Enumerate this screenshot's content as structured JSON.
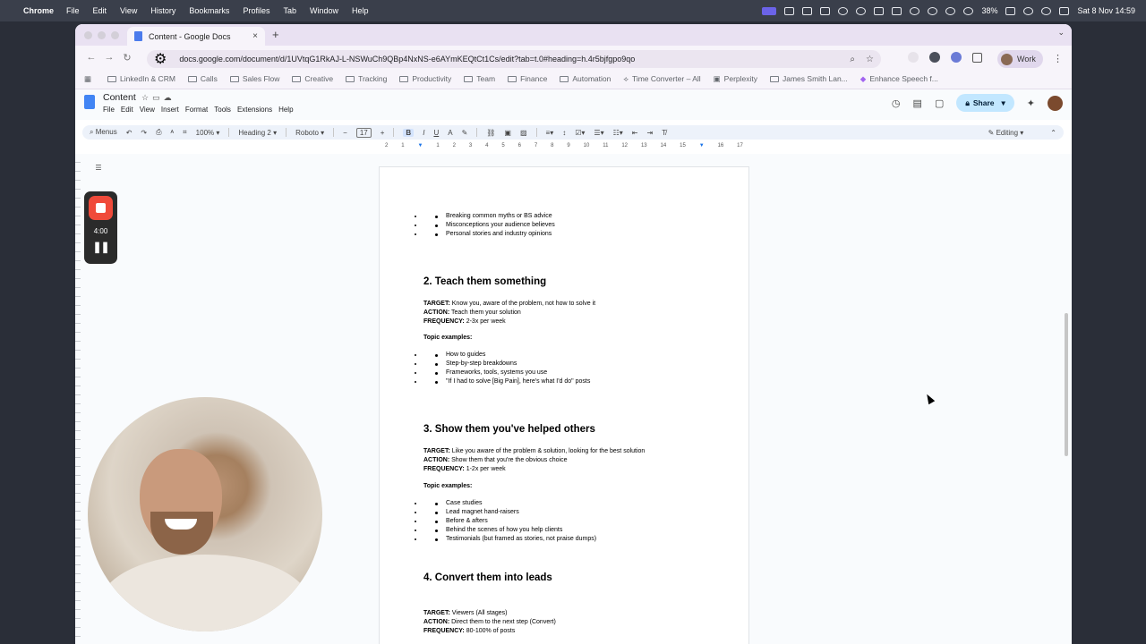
{
  "menubar": {
    "app": "Chrome",
    "items": [
      "File",
      "Edit",
      "View",
      "History",
      "Bookmarks",
      "Profiles",
      "Tab",
      "Window",
      "Help"
    ],
    "battery": "38%",
    "datetime": "Sat 8 Nov  14:59"
  },
  "browser": {
    "tab_title": "Content - Google Docs",
    "url": "docs.google.com/document/d/1UVtqG1RkAJ-L-NSWuCh9QBp4NxNS-e6AYmKEQtCt1Cs/edit?tab=t.0#heading=h.4r5bjfgpo9qo",
    "profile": "Work",
    "bookmarks": [
      "LinkedIn & CRM",
      "Calls",
      "Sales Flow",
      "Creative",
      "Tracking",
      "Productivity",
      "Team",
      "Finance",
      "Automation",
      "Time Converter – All",
      "Perplexity",
      "James Smith Lan...",
      "Enhance Speech f..."
    ]
  },
  "docs": {
    "title": "Content",
    "menus": [
      "File",
      "Edit",
      "View",
      "Insert",
      "Format",
      "Tools",
      "Extensions",
      "Help"
    ],
    "share": "Share",
    "toolbar": {
      "menus": "Menus",
      "zoom": "100%",
      "style": "Heading 2",
      "font": "Roboto",
      "size": "17",
      "mode": "Editing"
    },
    "ruler": [
      "2",
      "1",
      "1",
      "2",
      "3",
      "4",
      "5",
      "6",
      "7",
      "8",
      "9",
      "10",
      "11",
      "12",
      "13",
      "14",
      "15",
      "16",
      "17",
      "18"
    ]
  },
  "recorder": {
    "time": "4:00"
  },
  "content": {
    "bullets0": [
      "Breaking common myths or BS advice",
      "Misconceptions your audience believes",
      "Personal stories and industry opinions"
    ],
    "s2": {
      "heading": "2. Teach them something",
      "target_label": "TARGET:",
      "target": " Know you, aware of the problem, not how to solve it",
      "action_label": "ACTION:",
      "action": " Teach them your solution",
      "freq_label": "FREQUENCY:",
      "freq": " 2-3x per week",
      "topics": "Topic examples:",
      "bullets": [
        "How to guides",
        "Step-by-step breakdowns",
        "Frameworks, tools, systems you use",
        "\"If I had to solve [Big Pain], here's what I'd do\" posts"
      ]
    },
    "s3": {
      "heading": "3. Show them you've helped others",
      "target_label": "TARGET:",
      "target": " Like you aware of the problem & solution, looking for the best solution",
      "action_label": "ACTION:",
      "action": " Show them that you're the obvious choice",
      "freq_label": "FREQUENCY:",
      "freq": " 1-2x per week",
      "topics": "Topic examples:",
      "bullets": [
        "Case studies",
        "Lead magnet hand-raisers",
        "Before & afters",
        "Behind the scenes of how you help clients",
        "Testimonials (but framed as stories, not praise dumps)"
      ]
    },
    "s4": {
      "heading": "4. Convert them into leads",
      "target_label": "TARGET:",
      "target": " Viewers (All stages)",
      "action_label": "ACTION:",
      "action": " Direct them to the next step (Convert)",
      "freq_label": "FREQUENCY:",
      "freq": " 80-100% of posts"
    }
  }
}
